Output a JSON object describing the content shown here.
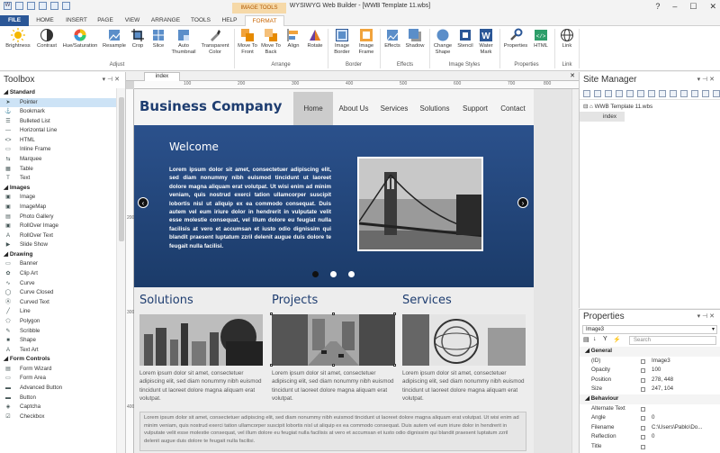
{
  "app": {
    "title": "WYSIWYG Web Builder - [WWB Template 11.wbs]",
    "context_tab": "IMAGE TOOLS"
  },
  "ribbon_tabs": [
    "FILE",
    "HOME",
    "INSERT",
    "PAGE",
    "VIEW",
    "ARRANGE",
    "TOOLS",
    "HELP",
    "FORMAT"
  ],
  "ribbon": {
    "adjust": {
      "label": "Adjust",
      "buttons": [
        "Brightness",
        "Contrast",
        "Hue/Saturation",
        "Resample",
        "Crop",
        "Slice",
        "Auto Thumbnail",
        "Transparent Color"
      ]
    },
    "arrange": {
      "label": "Arrange",
      "buttons": [
        "Move To Front",
        "Move To Back",
        "Align",
        "Rotate"
      ]
    },
    "border": {
      "label": "Border",
      "buttons": [
        "Image Border",
        "Image Frame"
      ]
    },
    "effects": {
      "label": "Effects",
      "buttons": [
        "Effects",
        "Shadow"
      ]
    },
    "image_styles": {
      "label": "Image Styles",
      "buttons": [
        "Change Shape",
        "Stencil",
        "Water Mark"
      ]
    },
    "properties": {
      "label": "Properties",
      "buttons": [
        "Properties",
        "HTML"
      ]
    },
    "link": {
      "label": "Link",
      "buttons": [
        "Link"
      ]
    }
  },
  "toolbox": {
    "title": "Toolbox",
    "sections": [
      {
        "name": "Standard",
        "items": [
          "Pointer",
          "Bookmark",
          "Bulleted List",
          "Horizontal Line",
          "HTML",
          "Inline Frame",
          "Marquee",
          "Table",
          "Text"
        ]
      },
      {
        "name": "Images",
        "items": [
          "Image",
          "ImageMap",
          "Photo Gallery",
          "RollOver Image",
          "RollOver Text",
          "Slide Show"
        ]
      },
      {
        "name": "Drawing",
        "items": [
          "Banner",
          "Clip Art",
          "Curve",
          "Curve Closed",
          "Curved Text",
          "Line",
          "Polygon",
          "Scribble",
          "Shape",
          "Text Art"
        ]
      },
      {
        "name": "Form Controls",
        "items": [
          "Form Wizard",
          "Form Area",
          "Advanced Button",
          "Button",
          "Captcha",
          "Checkbox"
        ]
      }
    ]
  },
  "document": {
    "tab": "index",
    "ruler_labels": [
      "100",
      "200",
      "300",
      "400",
      "500",
      "600",
      "700",
      "800"
    ],
    "ruler_v_labels": [
      "200",
      "300",
      "400"
    ]
  },
  "website": {
    "brand": "Business Company",
    "nav": [
      "Home",
      "About Us",
      "Services",
      "Solutions",
      "Support",
      "Contact"
    ],
    "hero_title": "Welcome",
    "hero_text": "Lorem ipsum dolor sit amet, consectetuer adipiscing elit, sed diam nonummy nibh euismod tincidunt ut laoreet dolore magna aliquam erat volutpat. Ut wisi enim ad minim veniam, quis nostrud exerci tation ullamcorper suscipit lobortis nisl ut aliquip ex ea commodo consequat. Duis autem vel eum iriure dolor in hendrerit in vulputate velit esse molestie consequat, vel illum dolore eu feugiat nulla facilisis at vero et accumsan et iusto odio dignissim qui blandit praesent luptatum zzril delenit augue duis dolore te feugait nulla facilisi.",
    "columns": [
      {
        "title": "Solutions",
        "text": "Lorem ipsum dolor sit amet, consectetuer adipiscing elit, sed diam nonummy nibh euismod tincidunt ut laoreet dolore magna aliquam erat volutpat."
      },
      {
        "title": "Projects",
        "text": "Lorem ipsum dolor sit amet, consectetuer adipiscing elit, sed diam nonummy nibh euismod tincidunt ut laoreet dolore magna aliquam erat volutpat."
      },
      {
        "title": "Services",
        "text": "Lorem ipsum dolor sit amet, consectetuer adipiscing elit, sed diam nonummy nibh euismod tincidunt ut laoreet dolore magna aliquam erat volutpat."
      }
    ],
    "footer_text": "Lorem ipsum dolor sit amet, consectetuer adipiscing elit, sed diam nonummy nibh euismod tincidunt ut laoreet dolore magna aliquam erat volutpat. Ut wisi enim ad minim veniam, quis nostrud exerci tation ullamcorper suscipit lobortis nisl ut aliquip ex ea commodo consequat. Duis autem vel eum iriure dolor in hendrerit in vulputate velit esse molestie consequat, vel illum dolore eu feugiat nulla facilisis at vero et accumsan et iusto odio dignissim qui blandit praesent luptatum zzril delenit augue duis dolore te feugait nulla facilisi."
  },
  "site_manager": {
    "title": "Site Manager",
    "root": "WWB Template 11.wbs",
    "page": "index"
  },
  "properties": {
    "title": "Properties",
    "object": "Image3",
    "search_placeholder": "Search",
    "categories": [
      {
        "name": "General",
        "rows": [
          {
            "key": "(ID)",
            "value": "Image3"
          },
          {
            "key": "Opacity",
            "value": "100"
          },
          {
            "key": "Position",
            "value": "278, 448"
          },
          {
            "key": "Size",
            "value": "247, 104"
          }
        ]
      },
      {
        "name": "Behaviour",
        "rows": [
          {
            "key": "Alternate Text",
            "value": ""
          },
          {
            "key": "Angle",
            "value": "0"
          },
          {
            "key": "Filename",
            "value": "C:\\Users\\Pablo\\Do..."
          },
          {
            "key": "Reflection",
            "value": "0"
          },
          {
            "key": "Title",
            "value": ""
          }
        ]
      }
    ]
  },
  "colors": {
    "file_tab": "#2b5797",
    "accent": "#c86400",
    "brand": "#1e3d70",
    "hero_top": "#2b518c",
    "hero_bottom": "#1b3b69"
  }
}
